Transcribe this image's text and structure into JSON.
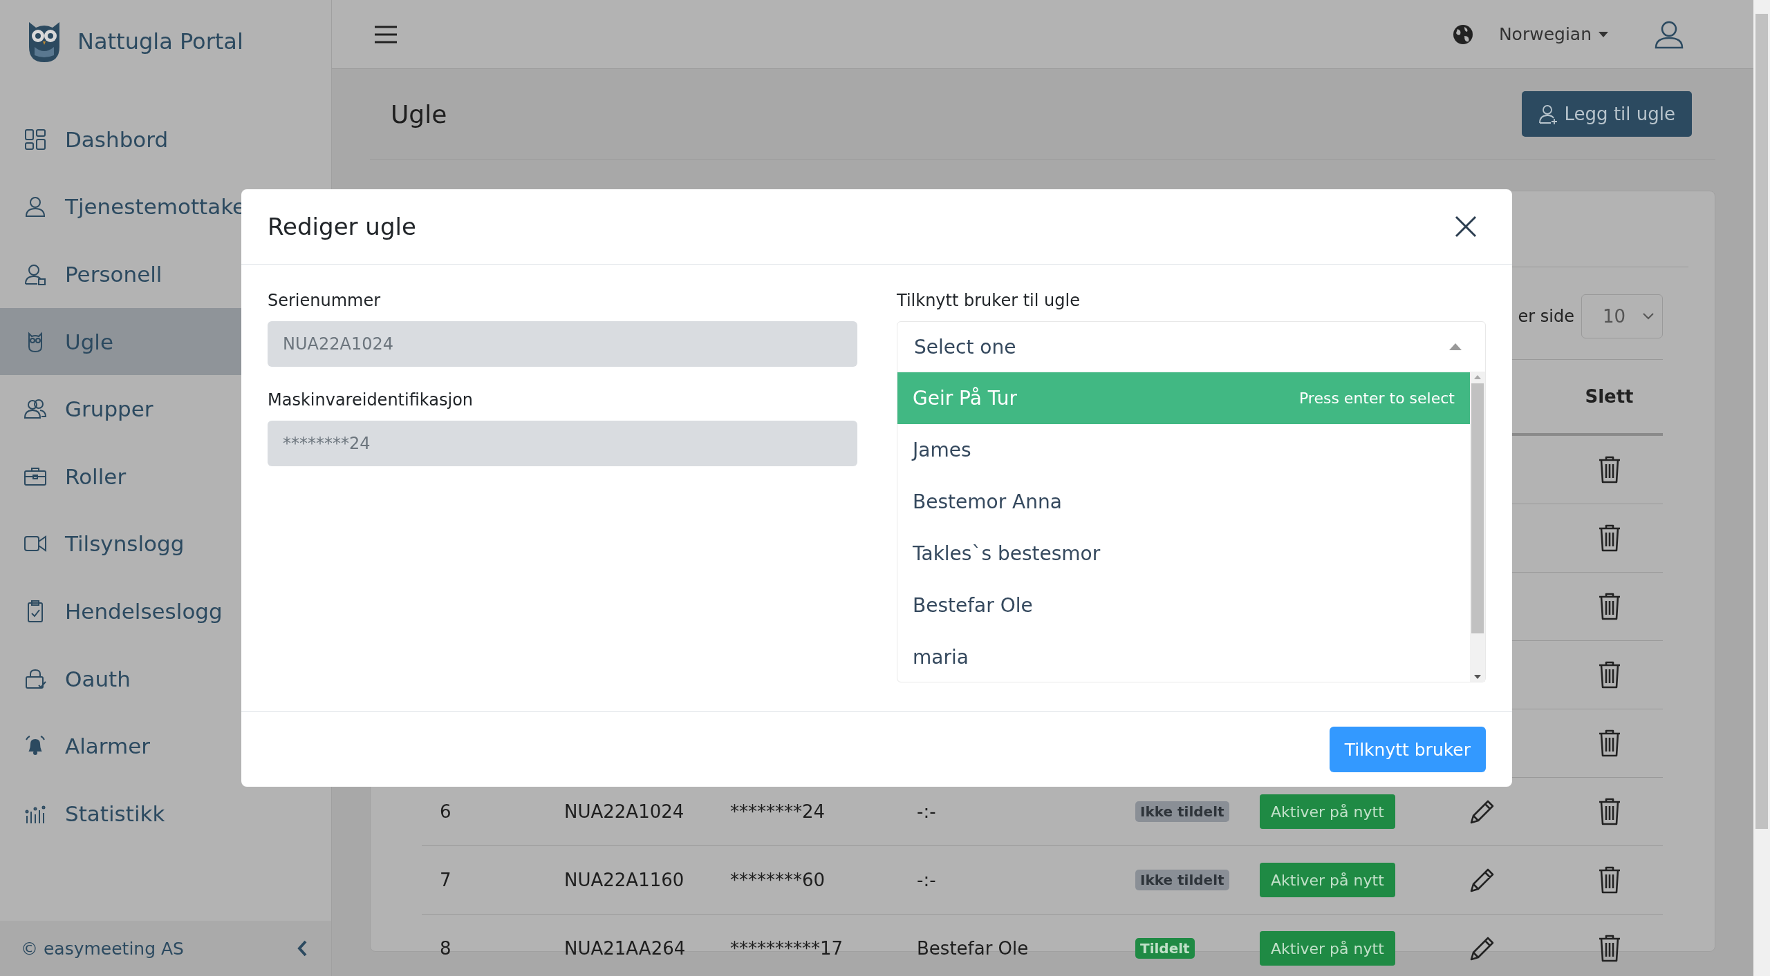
{
  "brand": {
    "name": "Nattugla Portal"
  },
  "sidebar": {
    "items": [
      {
        "label": "Dashbord",
        "kind": "grid",
        "selected": false
      },
      {
        "label": "Tjenestemottake",
        "kind": "person",
        "selected": false
      },
      {
        "label": "Personell",
        "kind": "staff",
        "selected": false
      },
      {
        "label": "Ugle",
        "kind": "owl",
        "selected": true
      },
      {
        "label": "Grupper",
        "kind": "group",
        "selected": false
      },
      {
        "label": "Roller",
        "kind": "briefcase",
        "selected": false
      },
      {
        "label": "Tilsynslogg",
        "kind": "camera",
        "selected": false
      },
      {
        "label": "Hendelseslogg",
        "kind": "clipboard",
        "selected": false
      },
      {
        "label": "Oauth",
        "kind": "lock",
        "selected": false
      },
      {
        "label": "Alarmer",
        "kind": "bell",
        "selected": false
      },
      {
        "label": "Statistikk",
        "kind": "chart",
        "selected": false
      }
    ],
    "footer": "© easymeeting AS"
  },
  "header": {
    "language": "Norwegian"
  },
  "page": {
    "title": "Ugle",
    "add_button": "Legg til ugle"
  },
  "table": {
    "per_page_label": "er side",
    "per_page_value": "10",
    "delete_column": "Slett",
    "rows": [
      {
        "kind": "covered"
      },
      {
        "kind": "covered"
      },
      {
        "kind": "covered"
      },
      {
        "kind": "covered"
      },
      {
        "kind": "covered"
      },
      {
        "kind": "full",
        "number": "6",
        "serial": "NUA22A1024",
        "hardware_id": "********24",
        "user": "-:-",
        "status": "Ikke tildelt",
        "assigned": false,
        "action": "Aktiver på nytt"
      },
      {
        "kind": "full",
        "number": "7",
        "serial": "NUA22A1160",
        "hardware_id": "********60",
        "user": "-:-",
        "status": "Ikke tildelt",
        "assigned": false,
        "action": "Aktiver på nytt"
      },
      {
        "kind": "full",
        "number": "8",
        "serial": "NUA21AA264",
        "hardware_id": "**********17",
        "user": "Bestefar Ole",
        "status": "Tildelt",
        "assigned": true,
        "action": "Aktiver på nytt"
      }
    ]
  },
  "modal": {
    "title": "Rediger ugle",
    "fields": [
      {
        "label": "Serienummer",
        "value": "NUA22A1024"
      },
      {
        "label": "Maskinvareidentifikasjon",
        "value": "********24"
      }
    ],
    "assign": {
      "label": "Tilknytt bruker til ugle",
      "placeholder": "Select one",
      "expanded": true,
      "hint": "Press enter to select",
      "options": [
        {
          "label": "Geir På Tur",
          "selected": true
        },
        {
          "label": "James",
          "selected": false
        },
        {
          "label": "Bestemor Anna",
          "selected": false
        },
        {
          "label": "Takles`s bestesmor",
          "selected": false
        },
        {
          "label": "Bestefar Ole",
          "selected": false
        },
        {
          "label": "maria",
          "selected": false
        }
      ]
    },
    "submit": "Tilknytt bruker"
  }
}
